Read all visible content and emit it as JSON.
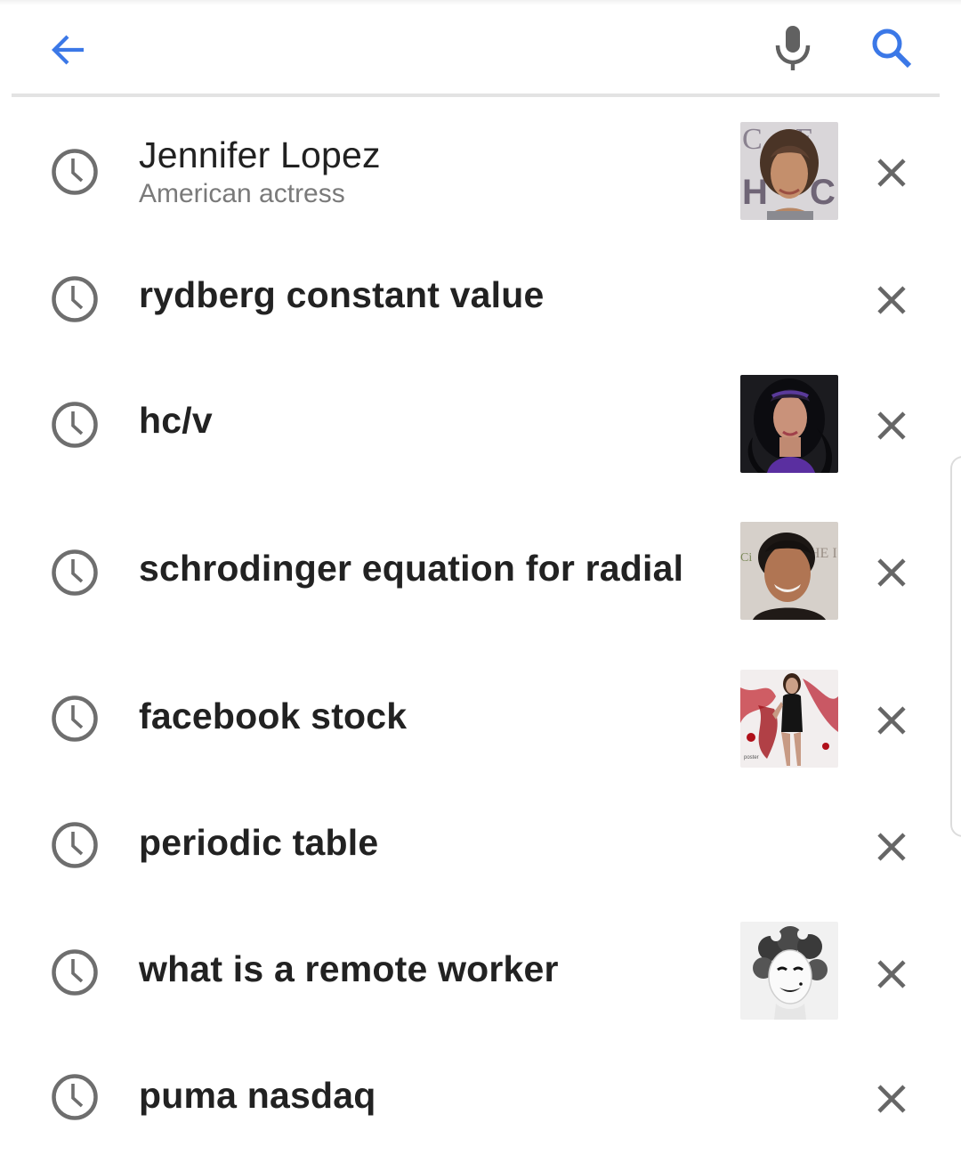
{
  "header": {
    "back_icon": "arrow-back-icon",
    "mic_icon": "microphone-icon",
    "search_icon": "search-icon",
    "accent_color": "#3b78e7"
  },
  "history": {
    "items": [
      {
        "title": "Jennifer Lopez",
        "subtitle": "American actress",
        "thumbnail": "portrait-photo",
        "remove_icon": "close-icon"
      },
      {
        "title": "rydberg constant value",
        "remove_icon": "close-icon"
      },
      {
        "title": "hc/v",
        "thumbnail": "portrait-photo",
        "remove_icon": "close-icon"
      },
      {
        "title": "schrodinger equation for radial",
        "thumbnail": "portrait-photo",
        "remove_icon": "close-icon"
      },
      {
        "title": "facebook stock",
        "thumbnail": "poster-photo",
        "remove_icon": "close-icon"
      },
      {
        "title": "periodic table",
        "remove_icon": "close-icon"
      },
      {
        "title": "what is a remote worker",
        "thumbnail": "portrait-photo",
        "remove_icon": "close-icon"
      },
      {
        "title": "puma nasdaq",
        "remove_icon": "close-icon"
      }
    ]
  }
}
